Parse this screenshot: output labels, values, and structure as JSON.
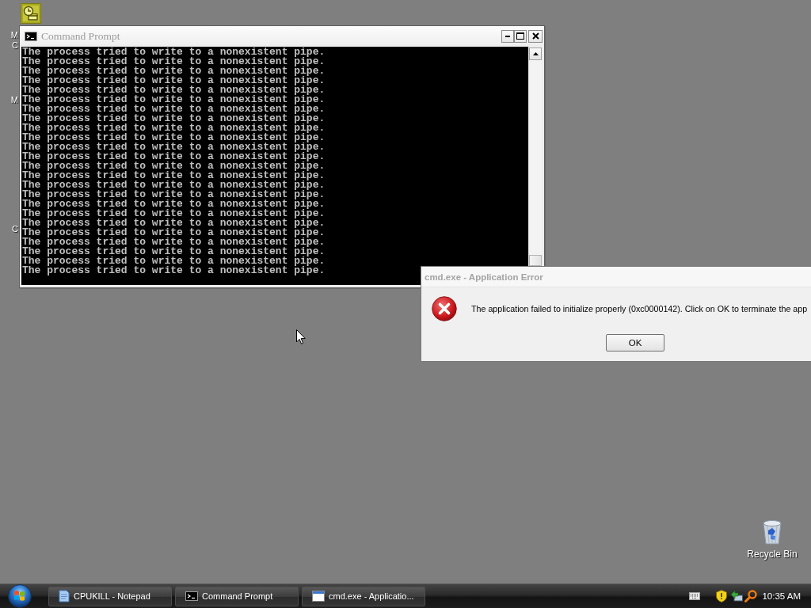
{
  "desktop_icons": [
    {
      "kind": "tile",
      "label_lines": [
        "M",
        "C"
      ]
    },
    {
      "label_lines": [
        "M"
      ]
    },
    {
      "label_lines": [
        "C"
      ]
    },
    {
      "kind": "recycle_bin",
      "label_lines": [
        "Recycle Bin"
      ]
    }
  ],
  "command_prompt": {
    "title": "Command Prompt",
    "active": false,
    "lines": [
      "The process tried to write to a nonexistent pipe.",
      "The process tried to write to a nonexistent pipe.",
      "The process tried to write to a nonexistent pipe.",
      "The process tried to write to a nonexistent pipe.",
      "The process tried to write to a nonexistent pipe.",
      "The process tried to write to a nonexistent pipe.",
      "The process tried to write to a nonexistent pipe.",
      "The process tried to write to a nonexistent pipe.",
      "The process tried to write to a nonexistent pipe.",
      "The process tried to write to a nonexistent pipe.",
      "The process tried to write to a nonexistent pipe.",
      "The process tried to write to a nonexistent pipe.",
      "The process tried to write to a nonexistent pipe.",
      "The process tried to write to a nonexistent pipe.",
      "The process tried to write to a nonexistent pipe.",
      "The process tried to write to a nonexistent pipe.",
      "The process tried to write to a nonexistent pipe.",
      "The process tried to write to a nonexistent pipe.",
      "The process tried to write to a nonexistent pipe.",
      "The process tried to write to a nonexistent pipe.",
      "The process tried to write to a nonexistent pipe.",
      "The process tried to write to a nonexistent pipe.",
      "The process tried to write to a nonexistent pipe.",
      "The process tried to write to a nonexistent pipe."
    ]
  },
  "error_dialog": {
    "title": "cmd.exe - Application Error",
    "active": false,
    "message": "The application failed to initialize properly (0xc0000142). Click on OK to terminate the app",
    "buttons": [
      "OK"
    ]
  },
  "taskbar": {
    "tasks": [
      {
        "kind": "notepad",
        "label": "CPUKILL - Notepad",
        "selected": false
      },
      {
        "kind": "console",
        "label": "Command Prompt",
        "selected": false
      },
      {
        "kind": "dialog",
        "label": "cmd.exe - Applicatio...",
        "selected": false
      }
    ],
    "clock": "10:35 AM"
  }
}
